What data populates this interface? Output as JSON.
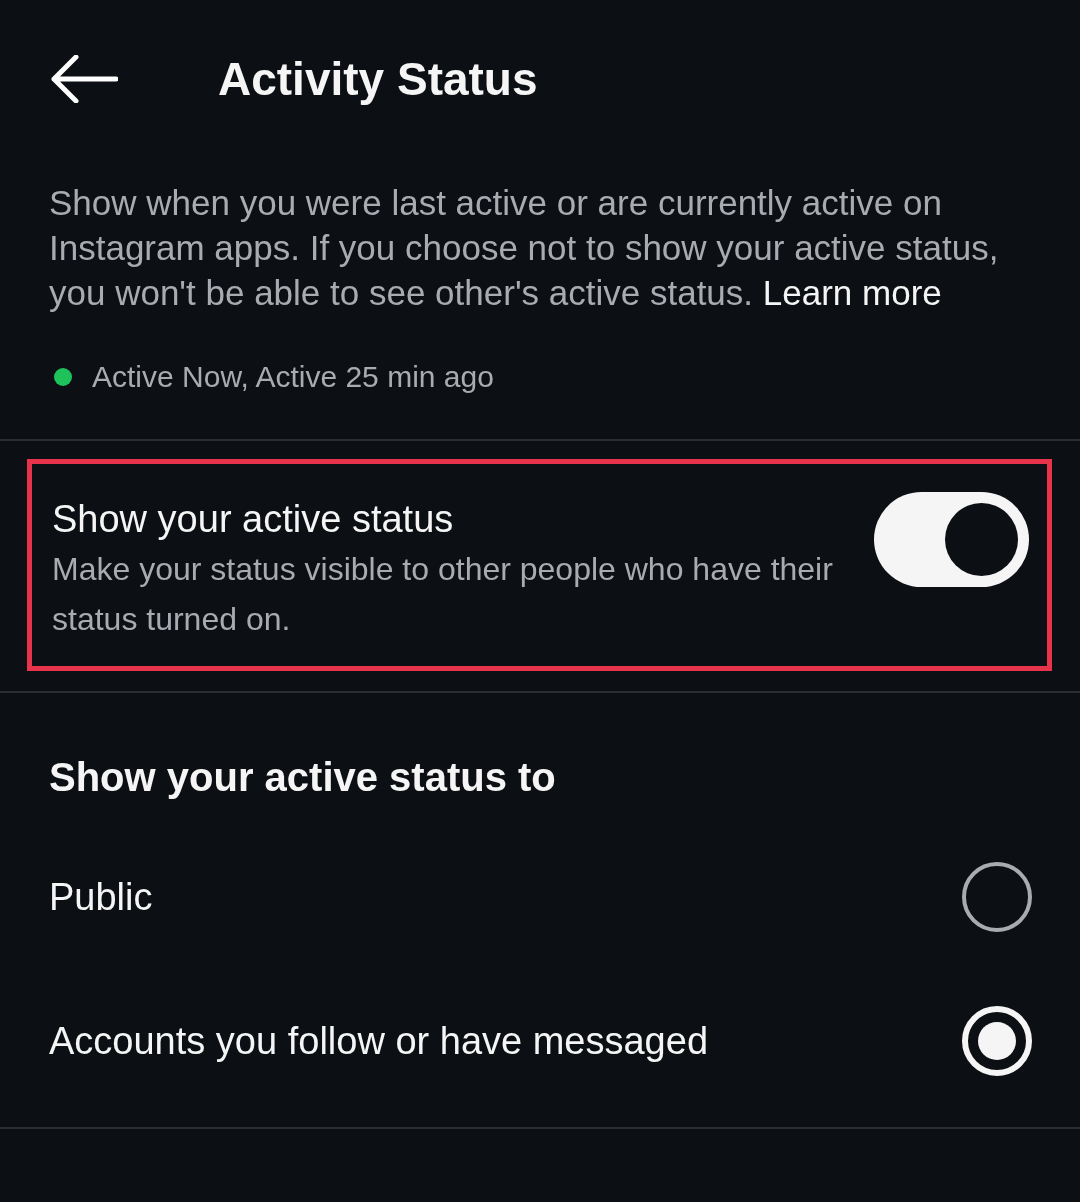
{
  "header": {
    "title": "Activity Status"
  },
  "description": {
    "text": "Show when you were last active or are currently active on Instagram apps. If you choose not to show your active status, you won't be able to see other's active status.",
    "link": "Learn more"
  },
  "status_preview": {
    "text": "Active Now, Active 25 min ago",
    "color": "#1ec25a"
  },
  "toggle_setting": {
    "title": "Show your active status",
    "subtitle": "Make your status visible to other people who have their status turned on.",
    "on": true,
    "highlighted": true
  },
  "audience": {
    "heading": "Show your active status to",
    "options": [
      {
        "label": "Public",
        "selected": false
      },
      {
        "label": "Accounts you follow or have messaged",
        "selected": true
      }
    ]
  }
}
